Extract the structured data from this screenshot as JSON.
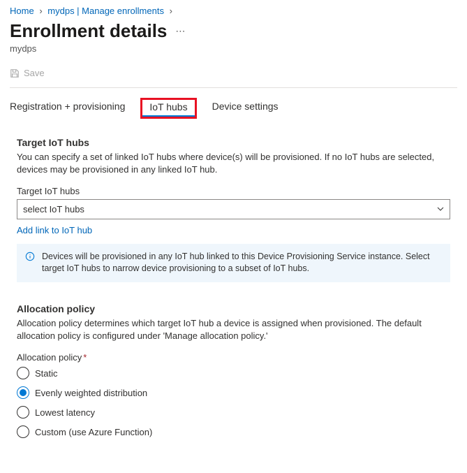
{
  "breadcrumb": {
    "home": "Home",
    "item2": "mydps | Manage enrollments"
  },
  "header": {
    "title": "Enrollment details",
    "subtitle": "mydps"
  },
  "toolbar": {
    "save_label": "Save"
  },
  "tabs": {
    "t1": "Registration + provisioning",
    "t2": "IoT hubs",
    "t3": "Device settings"
  },
  "sections": {
    "target": {
      "heading": "Target IoT hubs",
      "desc": "You can specify a set of linked IoT hubs where device(s) will be provisioned. If no IoT hubs are selected, devices may be provisioned in any linked IoT hub.",
      "field_label": "Target IoT hubs",
      "select_placeholder": "select IoT hubs",
      "add_link": "Add link to IoT hub",
      "info_text": "Devices will be provisioned in any IoT hub linked to this Device Provisioning Service instance. Select target IoT hubs to narrow device provisioning to a subset of IoT hubs."
    },
    "allocation": {
      "heading": "Allocation policy",
      "desc": "Allocation policy determines which target IoT hub a device is assigned when provisioned. The default allocation policy is configured under 'Manage allocation policy.'",
      "field_label": "Allocation policy",
      "options": {
        "o1": "Static",
        "o2": "Evenly weighted distribution",
        "o3": "Lowest latency",
        "o4": "Custom (use Azure Function)"
      },
      "selected": "o2"
    }
  }
}
